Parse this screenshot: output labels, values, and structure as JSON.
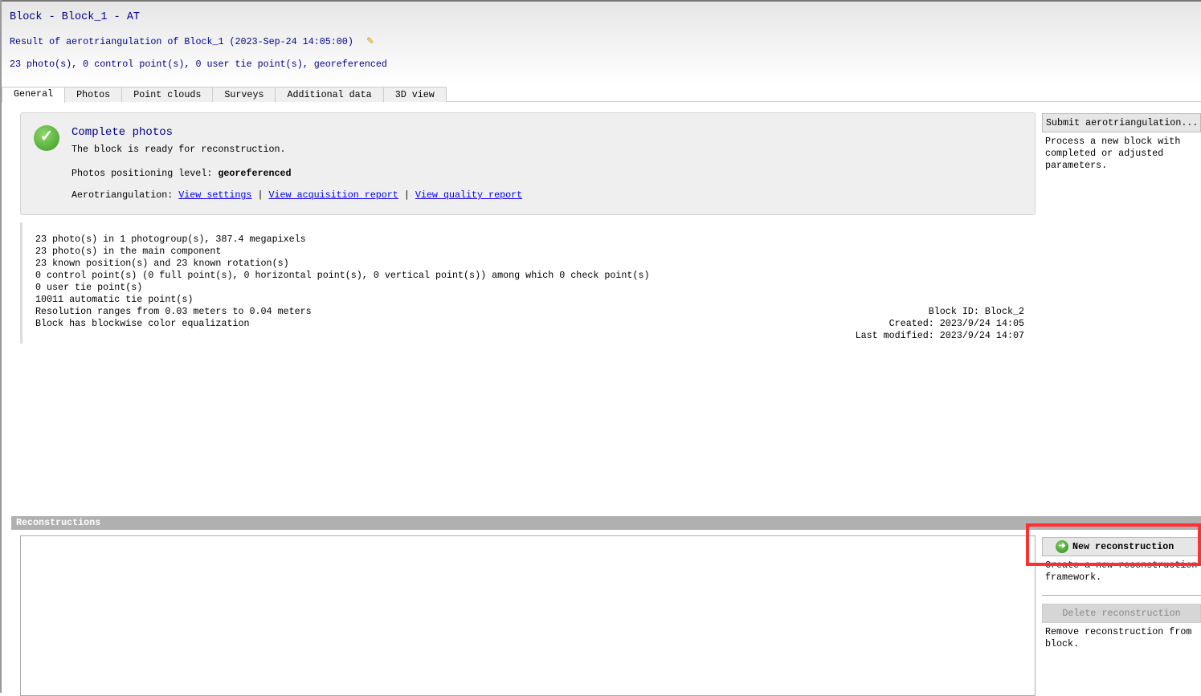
{
  "header": {
    "title": "Block - Block_1 - AT",
    "subtitle": "Result of aerotriangulation of Block_1 (2023-Sep-24 14:05:00)",
    "summary": "23 photo(s), 0 control point(s), 0 user tie point(s), georeferenced"
  },
  "tabs": [
    {
      "label": "General"
    },
    {
      "label": "Photos"
    },
    {
      "label": "Point clouds"
    },
    {
      "label": "Surveys"
    },
    {
      "label": "Additional data"
    },
    {
      "label": "3D view"
    }
  ],
  "status": {
    "title": "Complete photos",
    "desc": "The block is ready for reconstruction.",
    "level_label": "Photos positioning level:",
    "level_value": "georeferenced",
    "at_label": "Aerotriangulation:",
    "links": [
      "View settings",
      "View acquisition report",
      "View quality report"
    ],
    "sep": "|"
  },
  "stats": [
    "23 photo(s) in 1 photogroup(s), 387.4 megapixels",
    "23 photo(s) in the main component",
    "23 known position(s) and 23 known rotation(s)",
    "0 control point(s) (0 full point(s), 0 horizontal point(s), 0 vertical point(s)) among which 0 check point(s)",
    "0 user tie point(s)",
    "10011 automatic tie point(s)",
    "Resolution ranges from 0.03 meters to 0.04 meters",
    "Block has blockwise color equalization"
  ],
  "meta": {
    "block_id": "Block ID: Block_2",
    "created": "Created: 2023/9/24 14:05",
    "modified": "Last modified: 2023/9/24 14:07"
  },
  "side": {
    "submit_label": "Submit aerotriangulation...",
    "submit_desc": "Process a new block with completed or adjusted parameters.",
    "new_label": "New reconstruction",
    "new_desc": "Create a new reconstruction framework.",
    "delete_label": "Delete reconstruction",
    "delete_desc": "Remove reconstruction from block."
  },
  "reconstructions": {
    "title": "Reconstructions"
  }
}
